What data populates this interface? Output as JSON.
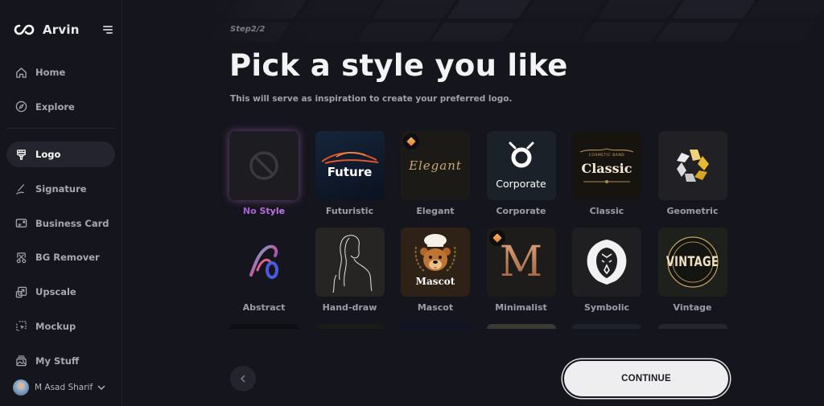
{
  "brand": {
    "name": "Arvin"
  },
  "sidebar": {
    "items": [
      {
        "label": "Home",
        "icon": "home-icon",
        "active": false
      },
      {
        "label": "Explore",
        "icon": "compass-icon",
        "active": false
      },
      {
        "label": "Logo",
        "icon": "brush-icon",
        "active": true
      },
      {
        "label": "Signature",
        "icon": "signature-pen-icon",
        "active": false
      },
      {
        "label": "Business Card",
        "icon": "business-card-icon",
        "active": false
      },
      {
        "label": "BG Remover",
        "icon": "scissors-icon",
        "active": false
      },
      {
        "label": "Upscale",
        "icon": "upscale-arrow-icon",
        "active": false
      },
      {
        "label": "Mockup",
        "icon": "mockup-cursor-icon",
        "active": false
      },
      {
        "label": "My Stuff",
        "icon": "image-stack-icon",
        "active": false
      }
    ],
    "user": {
      "name": "M Asad Sharif"
    }
  },
  "main": {
    "step": "Step2/2",
    "title": "Pick a style you like",
    "subtitle": "This will serve as inspiration to create your preferred logo.",
    "styles": [
      {
        "label": "No Style",
        "selected": true,
        "premium": false,
        "thumb_text": ""
      },
      {
        "label": "Futuristic",
        "selected": false,
        "premium": false,
        "thumb_text": "Future"
      },
      {
        "label": "Elegant",
        "selected": false,
        "premium": true,
        "thumb_text": "Elegant"
      },
      {
        "label": "Corporate",
        "selected": false,
        "premium": false,
        "thumb_text": "Corporate"
      },
      {
        "label": "Classic",
        "selected": false,
        "premium": false,
        "thumb_text": "Classic",
        "thumb_subtext": "COSMETIC BAND"
      },
      {
        "label": "Geometric",
        "selected": false,
        "premium": false,
        "thumb_text": ""
      },
      {
        "label": "Abstract",
        "selected": false,
        "premium": false,
        "thumb_text": ""
      },
      {
        "label": "Hand-draw",
        "selected": false,
        "premium": false,
        "thumb_text": ""
      },
      {
        "label": "Mascot",
        "selected": false,
        "premium": false,
        "thumb_text": "Mascot"
      },
      {
        "label": "Minimalist",
        "selected": false,
        "premium": true,
        "thumb_text": "M"
      },
      {
        "label": "Symbolic",
        "selected": false,
        "premium": false,
        "thumb_text": ""
      },
      {
        "label": "Vintage",
        "selected": false,
        "premium": false,
        "thumb_text": "VINTAGE"
      }
    ],
    "continue_label": "CONTINUE",
    "back_icon": "chevron-left-icon"
  },
  "colors": {
    "background": "#15161d",
    "selected_gradient_start": "#c96ce6",
    "selected_gradient_end": "#f0c070",
    "premium_badge": "#f0a050",
    "continue_bg": "#eeeef1"
  }
}
